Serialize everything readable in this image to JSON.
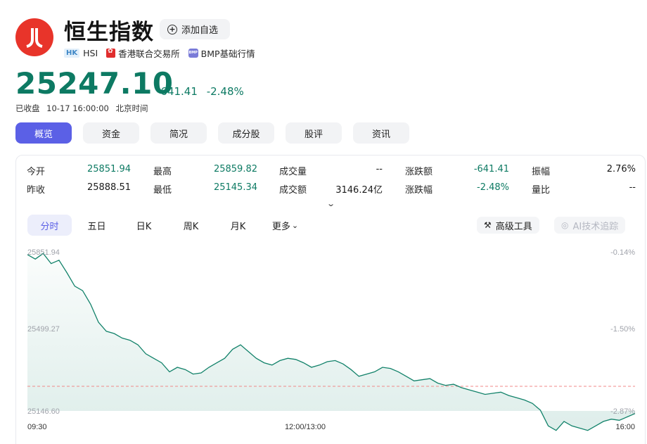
{
  "header": {
    "title": "恒生指数",
    "add_watchlist": "添加自选",
    "market_badge": "HK",
    "symbol": "HSI",
    "exchange": "香港联合交易所",
    "quote_source_badge": "BMP",
    "quote_source": "BMP基础行情"
  },
  "quote": {
    "price": "25247.10",
    "change": "-641.41",
    "change_pct": "-2.48%",
    "status": "已收盘",
    "date_time": "10-17 16:00:00",
    "timezone": "北京时间"
  },
  "tabs": [
    "概览",
    "资金",
    "简况",
    "成分股",
    "股评",
    "资讯"
  ],
  "stats": {
    "row1": [
      {
        "label": "今开",
        "value": "25851.94"
      },
      {
        "label": "最高",
        "value": "25859.82"
      },
      {
        "label": "成交量",
        "value": "--"
      },
      {
        "label": "涨跌额",
        "value": "-641.41"
      },
      {
        "label": "振幅",
        "value": "2.76%"
      }
    ],
    "row2": [
      {
        "label": "昨收",
        "value": "25888.51"
      },
      {
        "label": "最低",
        "value": "25145.34"
      },
      {
        "label": "成交额",
        "value": "3146.24亿"
      },
      {
        "label": "涨跌幅",
        "value": "-2.48%"
      },
      {
        "label": "量比",
        "value": "--"
      }
    ]
  },
  "periods": [
    "分时",
    "五日",
    "日K",
    "周K",
    "月K",
    "更多"
  ],
  "tools": {
    "advanced": "高级工具",
    "ai": "AI技术追踪"
  },
  "colors": {
    "accent": "#5b60e6",
    "down_green": "#0d7a63",
    "line": "#12826a",
    "prev_close_line": "#f08a8a"
  },
  "chart_data": {
    "type": "area",
    "y_labels_left": [
      "25851.94",
      "25499.27",
      "25146.60"
    ],
    "y_labels_right": [
      "-0.14%",
      "-1.50%",
      "-2.87%"
    ],
    "x_labels": [
      "09:30",
      "12:00/13:00",
      "16:00"
    ],
    "ylim": [
      25146.6,
      25851.94
    ],
    "prev_close": 25888.51,
    "values": [
      25840,
      25820,
      25845,
      25800,
      25815,
      25760,
      25700,
      25680,
      25620,
      25540,
      25500,
      25490,
      25470,
      25460,
      25440,
      25400,
      25380,
      25360,
      25320,
      25340,
      25330,
      25310,
      25315,
      25340,
      25360,
      25380,
      25420,
      25440,
      25410,
      25380,
      25360,
      25350,
      25370,
      25380,
      25375,
      25360,
      25340,
      25350,
      25365,
      25370,
      25355,
      25330,
      25300,
      25310,
      25320,
      25340,
      25335,
      25320,
      25300,
      25280,
      25285,
      25290,
      25270,
      25260,
      25265,
      25250,
      25240,
      25230,
      25220,
      25225,
      25230,
      25215,
      25205,
      25195,
      25180,
      25150,
      25080,
      25060,
      25100,
      25080,
      25070,
      25060,
      25080,
      25100,
      25110,
      25105,
      25120,
      25135
    ],
    "grid": false
  }
}
